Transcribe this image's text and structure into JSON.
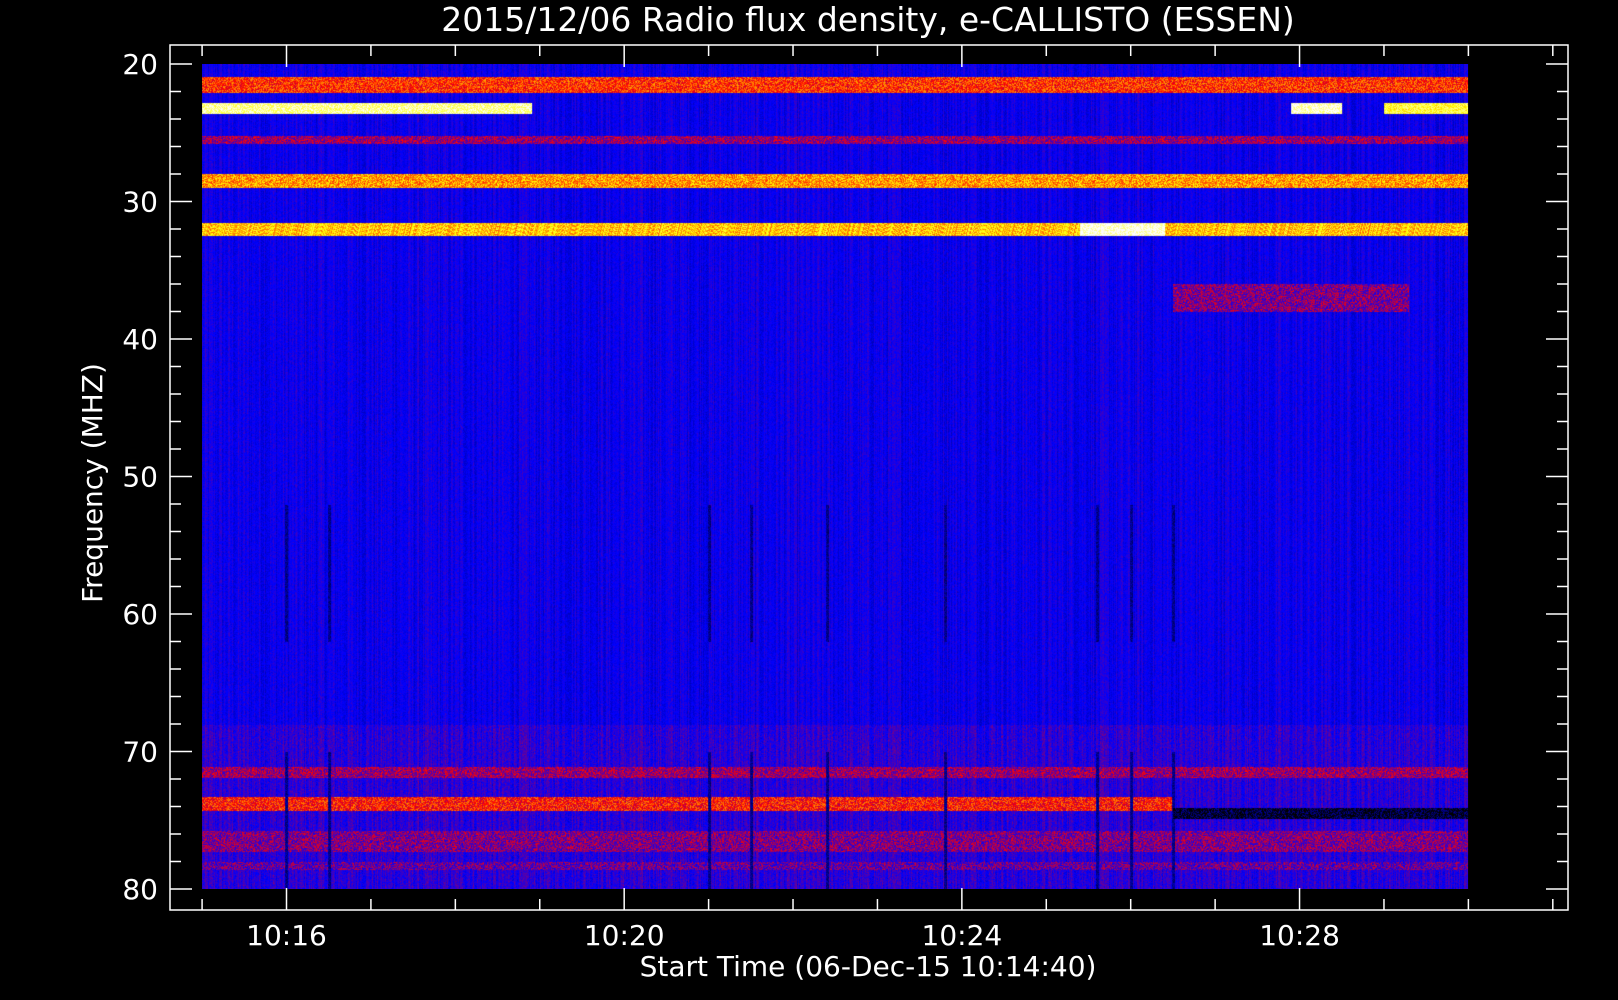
{
  "chart_data": {
    "type": "heatmap",
    "title": "2015/12/06  Radio flux density, e-CALLISTO (ESSEN)",
    "xlabel": "Start Time (06-Dec-15 10:14:40)",
    "ylabel": "Frequency (MHZ)",
    "x_ticks": [
      "10:16",
      "10:20",
      "10:24",
      "10:28"
    ],
    "x_tick_minutes": [
      16,
      20,
      24,
      28
    ],
    "x_range_minutes": [
      14.62,
      31.18
    ],
    "data_x_range_minutes": [
      15.0,
      30.0
    ],
    "y_ticks": [
      "20",
      "30",
      "40",
      "50",
      "60",
      "70",
      "80"
    ],
    "y_tick_values": [
      20,
      30,
      40,
      50,
      60,
      70,
      80
    ],
    "ylim": [
      80,
      20
    ],
    "y_inverted": true,
    "colormap": [
      "#000000",
      "#0000ff",
      "#ff0000",
      "#ffff00",
      "#ffffff"
    ],
    "background_color": "#0000ff",
    "bands": [
      {
        "freq": 21.5,
        "width": 1.2,
        "from": 15.0,
        "to": 30.0,
        "level": 2.2
      },
      {
        "freq": 23.2,
        "width": 0.8,
        "from": 15.0,
        "to": 18.9,
        "level": 3.6
      },
      {
        "freq": 23.2,
        "width": 0.8,
        "from": 27.9,
        "to": 28.5,
        "level": 3.8
      },
      {
        "freq": 23.2,
        "width": 0.8,
        "from": 29.0,
        "to": 30.0,
        "level": 3.2
      },
      {
        "freq": 25.5,
        "width": 0.6,
        "from": 15.0,
        "to": 30.0,
        "level": 1.6
      },
      {
        "freq": 28.5,
        "width": 1.0,
        "from": 15.0,
        "to": 30.0,
        "level": 2.6
      },
      {
        "freq": 32.0,
        "width": 1.0,
        "from": 15.0,
        "to": 30.0,
        "level": 2.8
      },
      {
        "freq": 32.0,
        "width": 1.0,
        "from": 25.4,
        "to": 26.4,
        "level": 3.9
      },
      {
        "freq": 37.0,
        "width": 2.0,
        "from": 26.5,
        "to": 29.3,
        "level": 1.5
      },
      {
        "freq": 71.5,
        "width": 0.8,
        "from": 15.0,
        "to": 30.0,
        "level": 1.6
      },
      {
        "freq": 73.8,
        "width": 1.0,
        "from": 15.0,
        "to": 26.5,
        "level": 2.1
      },
      {
        "freq": 74.5,
        "width": 0.8,
        "from": 26.5,
        "to": 30.0,
        "level": 0.2
      },
      {
        "freq": 76.5,
        "width": 1.5,
        "from": 15.0,
        "to": 30.0,
        "level": 1.5
      },
      {
        "freq": 78.3,
        "width": 0.6,
        "from": 15.0,
        "to": 30.0,
        "level": 1.4
      }
    ],
    "dark_columns": [
      16.0,
      16.5,
      21.0,
      21.5,
      22.4,
      23.8,
      25.6,
      26.0,
      26.5
    ]
  }
}
